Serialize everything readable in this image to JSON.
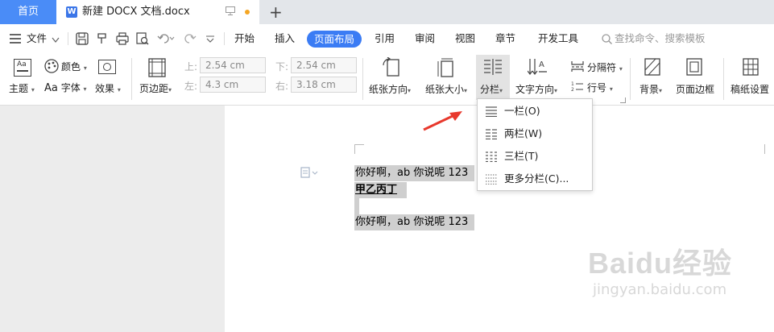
{
  "tabs": {
    "home": "首页",
    "document": "新建 DOCX 文档.docx",
    "doc_icon": "W",
    "new_tab": "+"
  },
  "menu": {
    "file": "文件",
    "items": [
      "开始",
      "插入",
      "页面布局",
      "引用",
      "审阅",
      "视图",
      "章节",
      "开发工具"
    ],
    "active": "页面布局",
    "search_placeholder": "查找命令、搜索模板"
  },
  "ribbon": {
    "theme": "主题",
    "colors": "颜色",
    "fonts": "字体",
    "effects": "效果",
    "margins": "页边距",
    "margin_top_label": "上:",
    "margin_top": "2.54 cm",
    "margin_bottom_label": "下:",
    "margin_bottom": "2.54 cm",
    "margin_left_label": "左:",
    "margin_left": "4.3 cm",
    "margin_right_label": "右:",
    "margin_right": "3.18 cm",
    "orientation": "纸张方向",
    "size": "纸张大小",
    "columns": "分栏",
    "text_direction": "文字方向",
    "breaks": "分隔符",
    "line_numbers": "行号",
    "background": "背景",
    "page_border": "页面边框",
    "manuscript": "稿纸设置"
  },
  "document": {
    "line1": "你好啊，ab 你说呢 123",
    "line2": "甲乙丙丁",
    "line3": "你好啊，ab 你说呢 123"
  },
  "columns_menu": {
    "items": [
      "一栏(O)",
      "两栏(W)",
      "三栏(T)",
      "更多分栏(C)..."
    ]
  },
  "watermark": {
    "brand": "Baidu经验",
    "url": "jingyan.baidu.com"
  },
  "colors": {
    "accent": "#3b7cf4",
    "home_tab": "#4a8cf7",
    "arrow": "#e8392d"
  }
}
